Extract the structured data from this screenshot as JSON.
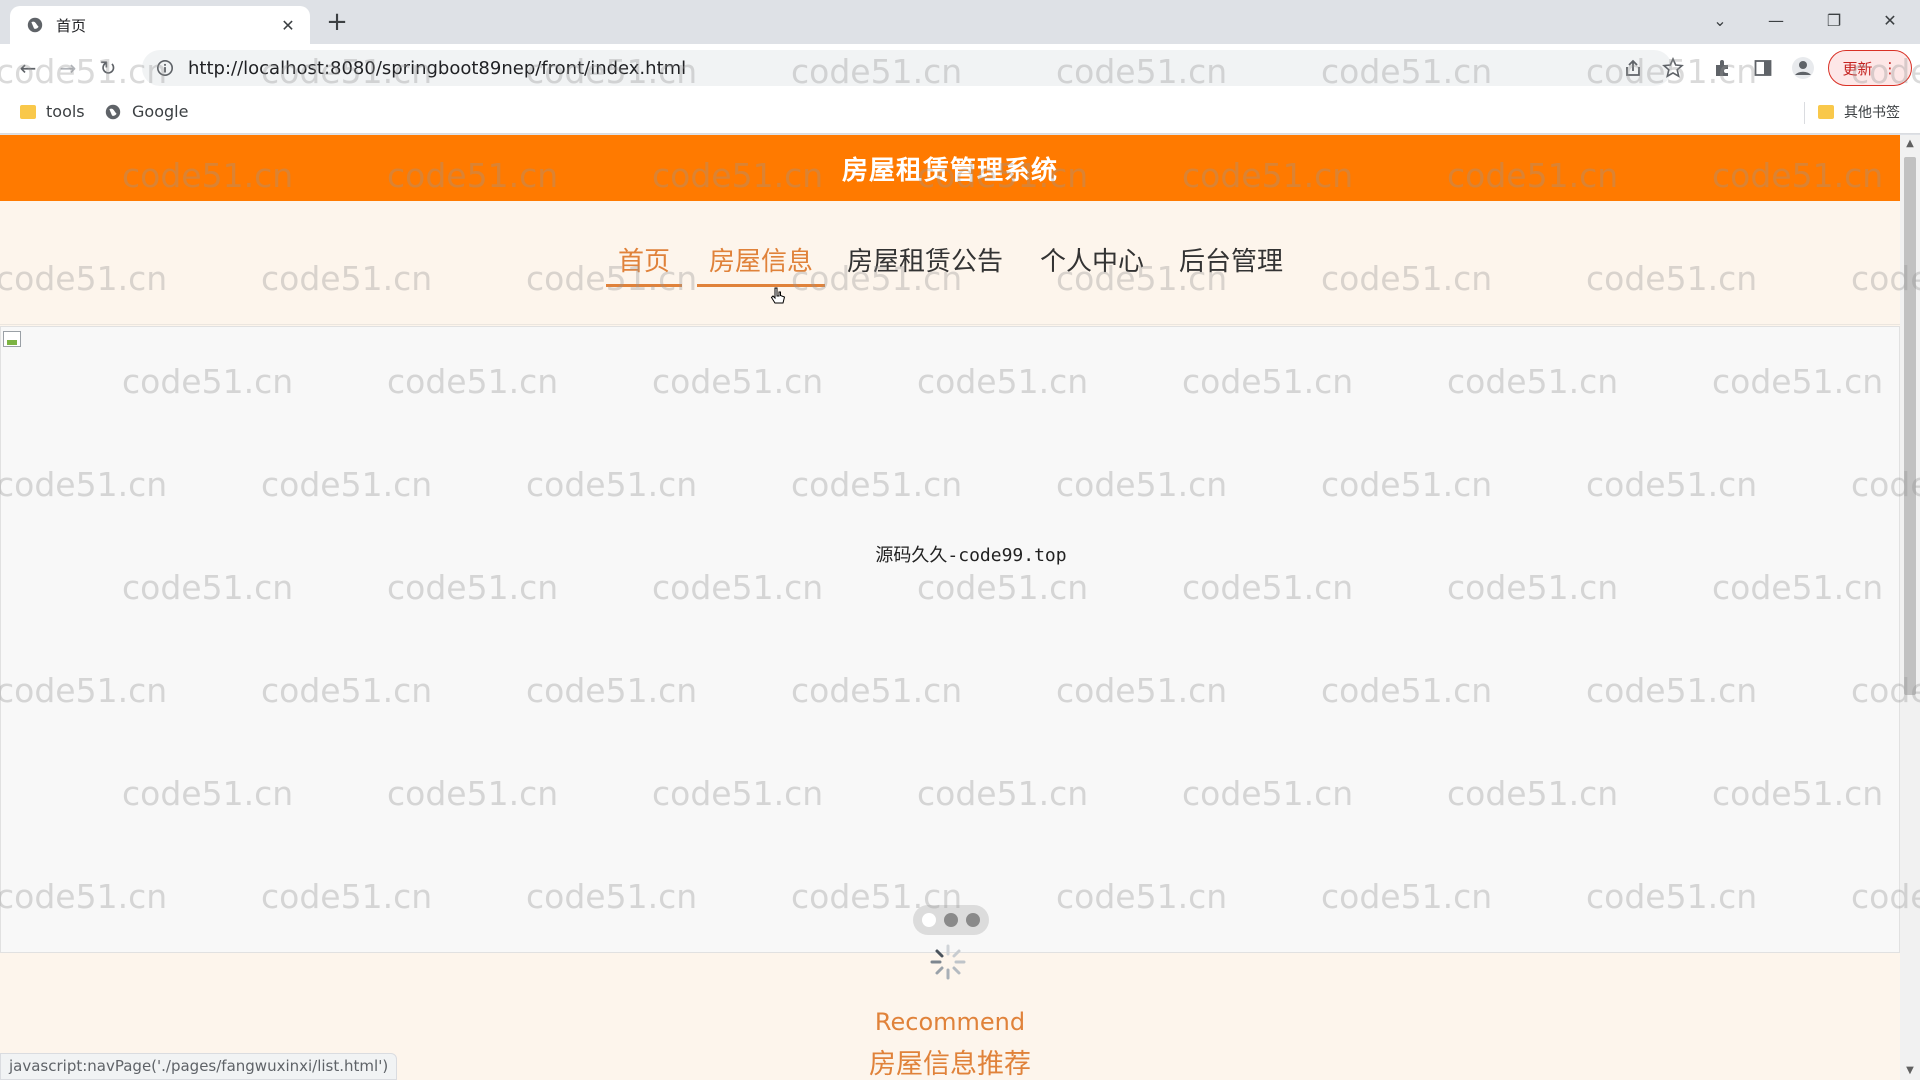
{
  "browser": {
    "tab_title": "首页",
    "url": "http://localhost:8080/springboot89nep/front/index.html",
    "update_label": "更新",
    "bookmarks": [
      {
        "label": "tools"
      },
      {
        "label": "Google"
      }
    ],
    "other_bookmarks_label": "其他书签"
  },
  "site": {
    "title": "房屋租赁管理系统",
    "nav": [
      {
        "label": "首页",
        "active": true
      },
      {
        "label": "房屋信息",
        "active": true
      },
      {
        "label": "房屋租赁公告",
        "active": false
      },
      {
        "label": "个人中心",
        "active": false
      },
      {
        "label": "后台管理",
        "active": false
      }
    ],
    "banner_caption": "源码久久-code99.top",
    "carousel_dots": 3,
    "carousel_active_index": 0,
    "recommend_en": "Recommend",
    "recommend_cn": "房屋信息推荐"
  },
  "status_bar": "javascript:navPage('./pages/fangwuxinxi/list.html')",
  "watermark_text": "code51.cn",
  "colors": {
    "header": "#ff7a00",
    "accent": "#e0823a",
    "page_bg": "#fdf5ec"
  }
}
